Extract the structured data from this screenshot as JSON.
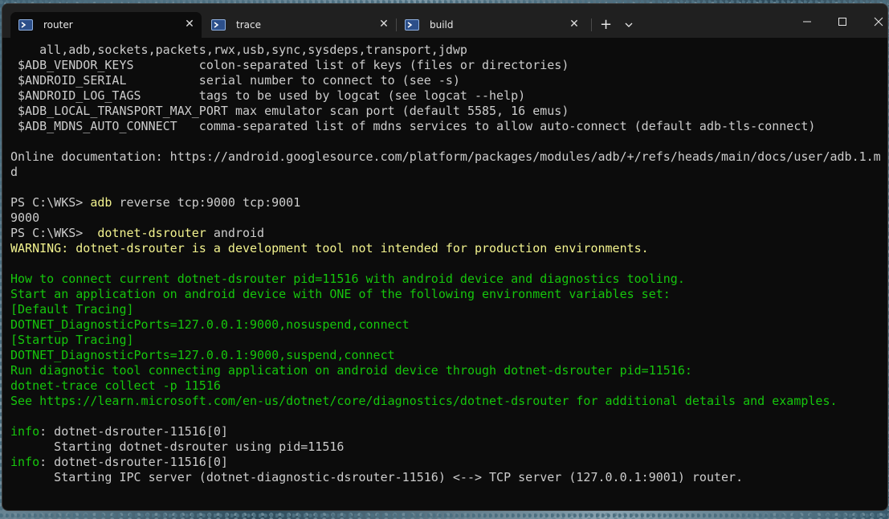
{
  "tabs": [
    {
      "title": "router"
    },
    {
      "title": "trace"
    },
    {
      "title": "build"
    }
  ],
  "window_controls": {
    "new_tab": "+",
    "dropdown": "⌄"
  },
  "terminal": {
    "lines": [
      {
        "text": "    all,adb,sockets,packets,rwx,usb,sync,sysdeps,transport,jdwp",
        "color": "default"
      },
      {
        "text": " $ADB_VENDOR_KEYS         colon-separated list of keys (files or directories)",
        "color": "default"
      },
      {
        "text": " $ANDROID_SERIAL          serial number to connect to (see -s)",
        "color": "default"
      },
      {
        "text": " $ANDROID_LOG_TAGS        tags to be used by logcat (see logcat --help)",
        "color": "default"
      },
      {
        "text": " $ADB_LOCAL_TRANSPORT_MAX_PORT max emulator scan port (default 5585, 16 emus)",
        "color": "default"
      },
      {
        "text": " $ADB_MDNS_AUTO_CONNECT   comma-separated list of mdns services to allow auto-connect (default adb-tls-connect)",
        "color": "default"
      },
      {
        "text": "",
        "color": "default"
      },
      {
        "text": "Online documentation: https://android.googlesource.com/platform/packages/modules/adb/+/refs/heads/main/docs/user/adb.1.m",
        "color": "default"
      },
      {
        "text": "d",
        "color": "default"
      },
      {
        "text": "",
        "color": "default"
      },
      {
        "prompt": "PS C:\\WKS> ",
        "command": "adb",
        "args": " reverse tcp:9000 tcp:9001"
      },
      {
        "text": "9000",
        "color": "default"
      },
      {
        "prompt": "PS C:\\WKS>  ",
        "command": "dotnet-dsrouter",
        "args": " android"
      },
      {
        "text": "WARNING: dotnet-dsrouter is a development tool not intended for production environments.",
        "color": "yellow"
      },
      {
        "text": "",
        "color": "default"
      },
      {
        "text": "How to connect current dotnet-dsrouter pid=11516 with android device and diagnostics tooling.",
        "color": "green"
      },
      {
        "text": "Start an application on android device with ONE of the following environment variables set:",
        "color": "green"
      },
      {
        "text": "[Default Tracing]",
        "color": "green"
      },
      {
        "text": "DOTNET_DiagnosticPorts=127.0.0.1:9000,nosuspend,connect",
        "color": "green"
      },
      {
        "text": "[Startup Tracing]",
        "color": "green"
      },
      {
        "text": "DOTNET_DiagnosticPorts=127.0.0.1:9000,suspend,connect",
        "color": "green"
      },
      {
        "text": "Run diagnotic tool connecting application on android device through dotnet-dsrouter pid=11516:",
        "color": "green"
      },
      {
        "text": "dotnet-trace collect -p 11516",
        "color": "green"
      },
      {
        "text": "See https://learn.microsoft.com/en-us/dotnet/core/diagnostics/dotnet-dsrouter for additional details and examples.",
        "color": "green"
      },
      {
        "text": "",
        "color": "default"
      },
      {
        "label": "info",
        "rest": ": dotnet-dsrouter-11516[0]"
      },
      {
        "text": "      Starting dotnet-dsrouter using pid=11516",
        "color": "default"
      },
      {
        "label": "info",
        "rest": ": dotnet-dsrouter-11516[0]"
      },
      {
        "text": "      Starting IPC server (dotnet-diagnostic-dsrouter-11516) <--> TCP server (127.0.0.1:9001) router.",
        "color": "default"
      }
    ]
  },
  "colors": {
    "yellow": "#f2f28e",
    "green": "#16c60c",
    "text": "#cccccc",
    "background": "#0c0c0c"
  }
}
